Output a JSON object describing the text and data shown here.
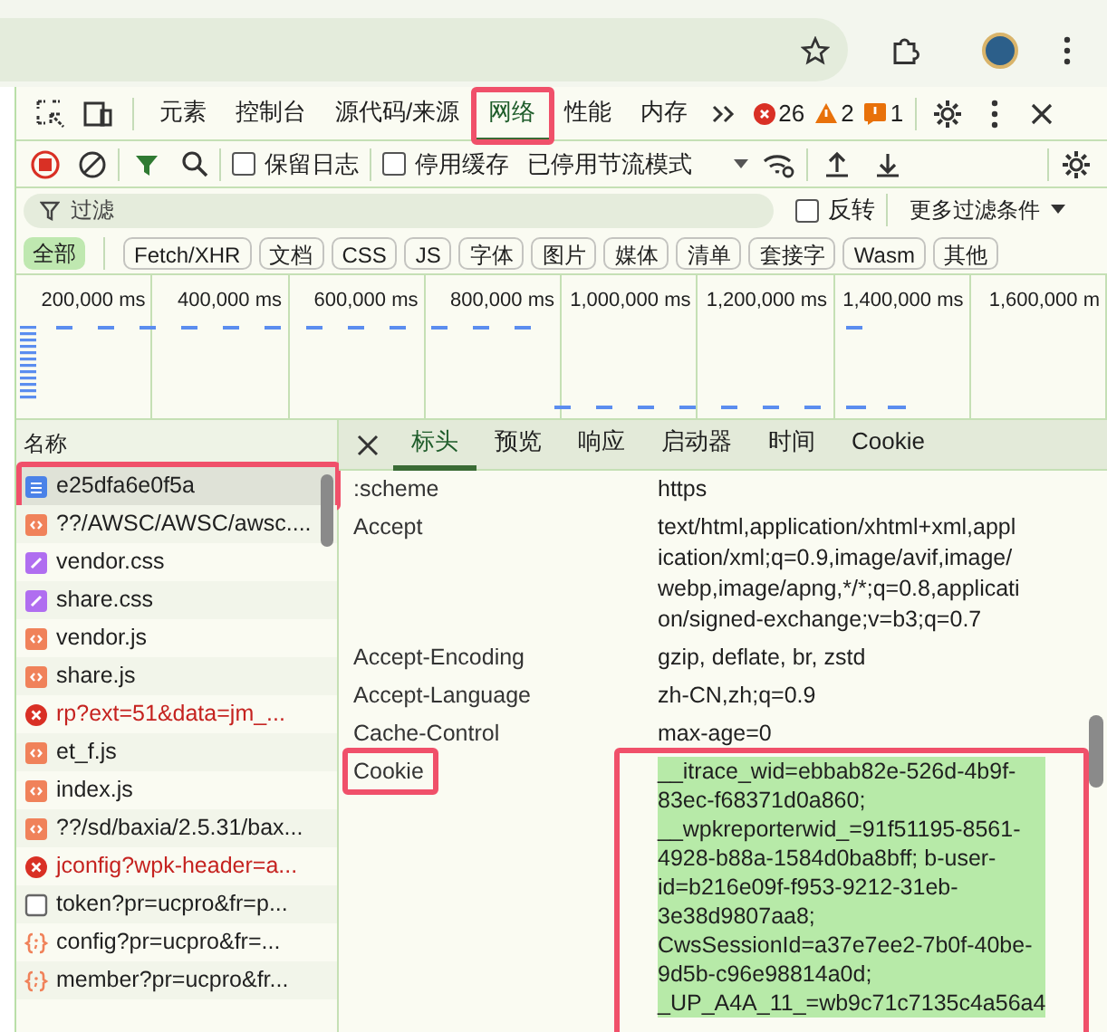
{
  "devtools": {
    "tabs": [
      {
        "label": "元素",
        "selected": false,
        "annotated": false
      },
      {
        "label": "控制台",
        "selected": false,
        "annotated": false
      },
      {
        "label": "源代码/来源",
        "selected": false,
        "annotated": false
      },
      {
        "label": "网络",
        "selected": true,
        "annotated": true
      },
      {
        "label": "性能",
        "selected": false,
        "annotated": false
      },
      {
        "label": "内存",
        "selected": false,
        "annotated": false
      }
    ],
    "issues": [
      {
        "kind": "error",
        "count": "26"
      },
      {
        "kind": "warning",
        "count": "2"
      },
      {
        "kind": "info",
        "count": "1"
      }
    ],
    "network_toolbar": {
      "recording": true,
      "preserve_log": {
        "label": "保留日志",
        "checked": false
      },
      "disable_cache": {
        "label": "停用缓存",
        "checked": false
      },
      "throttling": "已停用节流模式"
    },
    "filter": {
      "placeholder": "过滤",
      "invert": {
        "label": "反转",
        "checked": false
      },
      "more_filters": "更多过滤条件"
    },
    "type_filters": [
      {
        "label": "全部",
        "selected": true
      },
      {
        "label": "Fetch/XHR",
        "selected": false
      },
      {
        "label": "文档",
        "selected": false
      },
      {
        "label": "CSS",
        "selected": false
      },
      {
        "label": "JS",
        "selected": false
      },
      {
        "label": "字体",
        "selected": false
      },
      {
        "label": "图片",
        "selected": false
      },
      {
        "label": "媒体",
        "selected": false
      },
      {
        "label": "清单",
        "selected": false
      },
      {
        "label": "套接字",
        "selected": false
      },
      {
        "label": "Wasm",
        "selected": false
      },
      {
        "label": "其他",
        "selected": false
      }
    ],
    "timeline": {
      "ticks": [
        "200,000 ms",
        "400,000 ms",
        "600,000 ms",
        "800,000 ms",
        "1,000,000 ms",
        "1,200,000 ms",
        "1,400,000 ms",
        "1,600,000 m"
      ]
    },
    "requests": {
      "column": "名称",
      "rows": [
        {
          "name": "e25dfa6e0f5a",
          "kind": "document",
          "selected": true,
          "annotated": true
        },
        {
          "name": "??/AWSC/AWSC/awsc....",
          "kind": "script",
          "selected": false,
          "annotated": false
        },
        {
          "name": "vendor.css",
          "kind": "stylesheet",
          "selected": false,
          "annotated": false
        },
        {
          "name": "share.css",
          "kind": "stylesheet",
          "selected": false,
          "annotated": false
        },
        {
          "name": "vendor.js",
          "kind": "script",
          "selected": false,
          "annotated": false
        },
        {
          "name": "share.js",
          "kind": "script",
          "selected": false,
          "annotated": false
        },
        {
          "name": "rp?ext=51&data=jm_...",
          "kind": "failed",
          "selected": false,
          "annotated": false
        },
        {
          "name": "et_f.js",
          "kind": "script",
          "selected": false,
          "annotated": false
        },
        {
          "name": "index.js",
          "kind": "script",
          "selected": false,
          "annotated": false
        },
        {
          "name": "??/sd/baxia/2.5.31/bax...",
          "kind": "script",
          "selected": false,
          "annotated": false
        },
        {
          "name": "jconfig?wpk-header=a...",
          "kind": "failed",
          "selected": false,
          "annotated": false
        },
        {
          "name": "token?pr=ucpro&fr=p...",
          "kind": "other",
          "selected": false,
          "annotated": false
        },
        {
          "name": "config?pr=ucpro&fr=...",
          "kind": "fetch",
          "selected": false,
          "annotated": false
        },
        {
          "name": "member?pr=ucpro&fr...",
          "kind": "fetch",
          "selected": false,
          "annotated": false
        }
      ]
    },
    "detail_tabs": [
      {
        "label": "标头",
        "selected": true
      },
      {
        "label": "预览",
        "selected": false
      },
      {
        "label": "响应",
        "selected": false
      },
      {
        "label": "启动器",
        "selected": false
      },
      {
        "label": "时间",
        "selected": false
      },
      {
        "label": "Cookie",
        "selected": false
      }
    ],
    "headers": [
      {
        "name": ":scheme",
        "value": "https",
        "annotated": false,
        "highlighted": false
      },
      {
        "name": "Accept",
        "value": "text/html,application/xhtml+xml,appl\nication/xml;q=0.9,image/avif,image/\nwebp,image/apng,*/*;q=0.8,applicati\non/signed-exchange;v=b3;q=0.7",
        "annotated": false,
        "highlighted": false
      },
      {
        "name": "Accept-Encoding",
        "value": "gzip, deflate, br, zstd",
        "annotated": false,
        "highlighted": false
      },
      {
        "name": "Accept-Language",
        "value": "zh-CN,zh;q=0.9",
        "annotated": false,
        "highlighted": false
      },
      {
        "name": "Cache-Control",
        "value": "max-age=0",
        "annotated": false,
        "highlighted": false
      },
      {
        "name": "Cookie",
        "value": "__itrace_wid=ebbab82e-526d-4b9f-\n83ec-f68371d0a860;\n__wpkreporterwid_=91f51195-8561-\n4928-b88a-1584d0ba8bff; b-user-\nid=b216e09f-f953-9212-31eb-\n3e38d9807aa8;\nCwsSessionId=a37e7ee2-7b0f-40be-\n9d5b-c96e98814a0d;\n_UP_A4A_11_=wb9c71c7135c4a56a4",
        "annotated": true,
        "highlighted": true
      }
    ]
  }
}
